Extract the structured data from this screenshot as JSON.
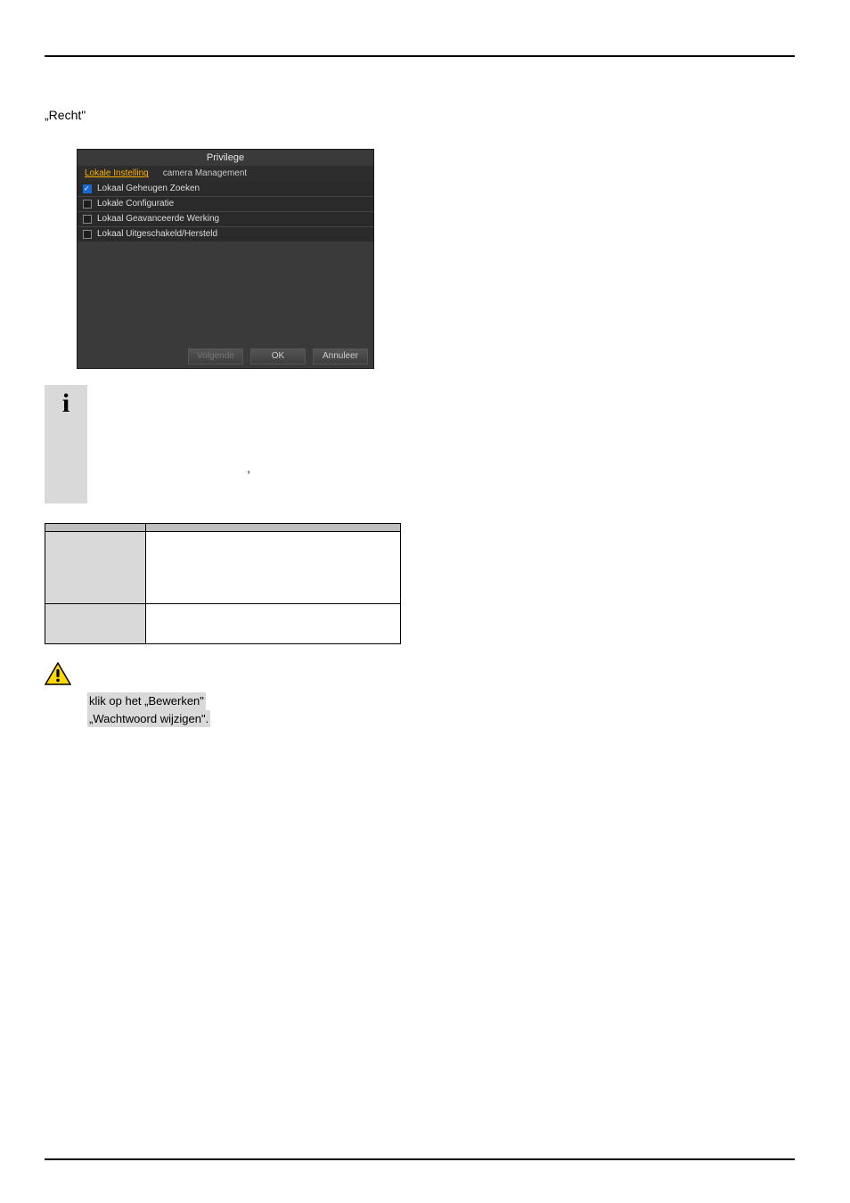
{
  "intro_prefix": "„",
  "intro_link": "Recht",
  "intro_suffix": "\"",
  "dialog": {
    "title": "Privilege",
    "tab_active": "Lokale Instelling",
    "tab_other": "camera Management",
    "perms": [
      {
        "label": "Lokaal Geheugen Zoeken",
        "checked": true
      },
      {
        "label": "Lokale Configuratie",
        "checked": false
      },
      {
        "label": "Lokaal Geavanceerde Werking",
        "checked": false
      },
      {
        "label": "Lokaal Uitgeschakeld/Hersteld",
        "checked": false
      }
    ],
    "btn_prev": "Volgende",
    "btn_ok": "OK",
    "btn_cancel": "Annuleer"
  },
  "info_text": ",",
  "table": {
    "h1": "",
    "h2": "",
    "r1c1": "",
    "r1c2": "",
    "r2c1": "",
    "r2c2": ""
  },
  "warn": {
    "line1": "klik op het „Bewerken\"",
    "line2": "„Wachtwoord wijzigen\"."
  }
}
